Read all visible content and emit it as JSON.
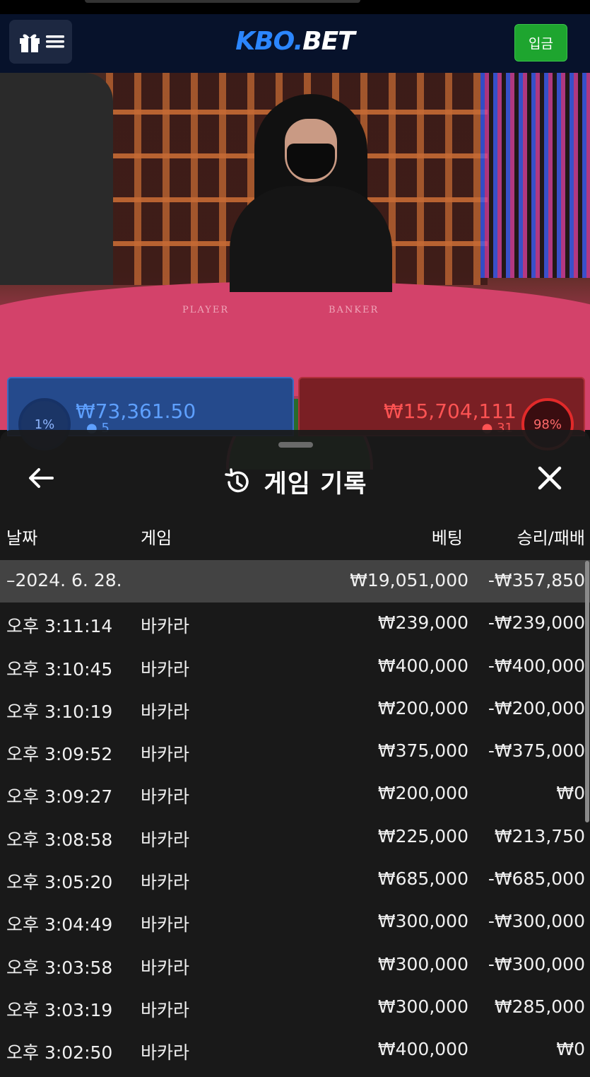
{
  "header": {
    "logo": {
      "part1": "KBO",
      "part2": ".",
      "part3": "BET"
    },
    "deposit_label": "입금"
  },
  "video": {
    "player_label": "PLAYER",
    "banker_label": "BANKER",
    "player": {
      "percent": "1%",
      "amount": "₩73,361.50",
      "count": "5"
    },
    "banker": {
      "percent": "98%",
      "amount": "₩15,704,111",
      "count": "31"
    }
  },
  "history": {
    "title": "게임 기록",
    "columns": {
      "date": "날짜",
      "game": "게임",
      "bet": "베팅",
      "result": "승리/패배"
    },
    "summary": {
      "date": "–2024. 6. 28.",
      "bet": "₩19,051,000",
      "result": "-₩357,850"
    },
    "rows": [
      {
        "time": "오후 3:11:14",
        "game": "바카라",
        "bet": "₩239,000",
        "result": "-₩239,000"
      },
      {
        "time": "오후 3:10:45",
        "game": "바카라",
        "bet": "₩400,000",
        "result": "-₩400,000"
      },
      {
        "time": "오후 3:10:19",
        "game": "바카라",
        "bet": "₩200,000",
        "result": "-₩200,000"
      },
      {
        "time": "오후 3:09:52",
        "game": "바카라",
        "bet": "₩375,000",
        "result": "-₩375,000"
      },
      {
        "time": "오후 3:09:27",
        "game": "바카라",
        "bet": "₩200,000",
        "result": "₩0"
      },
      {
        "time": "오후 3:08:58",
        "game": "바카라",
        "bet": "₩225,000",
        "result": "₩213,750"
      },
      {
        "time": "오후 3:05:20",
        "game": "바카라",
        "bet": "₩685,000",
        "result": "-₩685,000"
      },
      {
        "time": "오후 3:04:49",
        "game": "바카라",
        "bet": "₩300,000",
        "result": "-₩300,000"
      },
      {
        "time": "오후 3:03:58",
        "game": "바카라",
        "bet": "₩300,000",
        "result": "-₩300,000"
      },
      {
        "time": "오후 3:03:19",
        "game": "바카라",
        "bet": "₩300,000",
        "result": "₩285,000"
      },
      {
        "time": "오후 3:02:50",
        "game": "바카라",
        "bet": "₩400,000",
        "result": "₩0"
      }
    ]
  },
  "colors": {
    "brand_blue": "#2b86ff",
    "deposit_green": "#1ea52f",
    "topbar": "#07122b"
  }
}
